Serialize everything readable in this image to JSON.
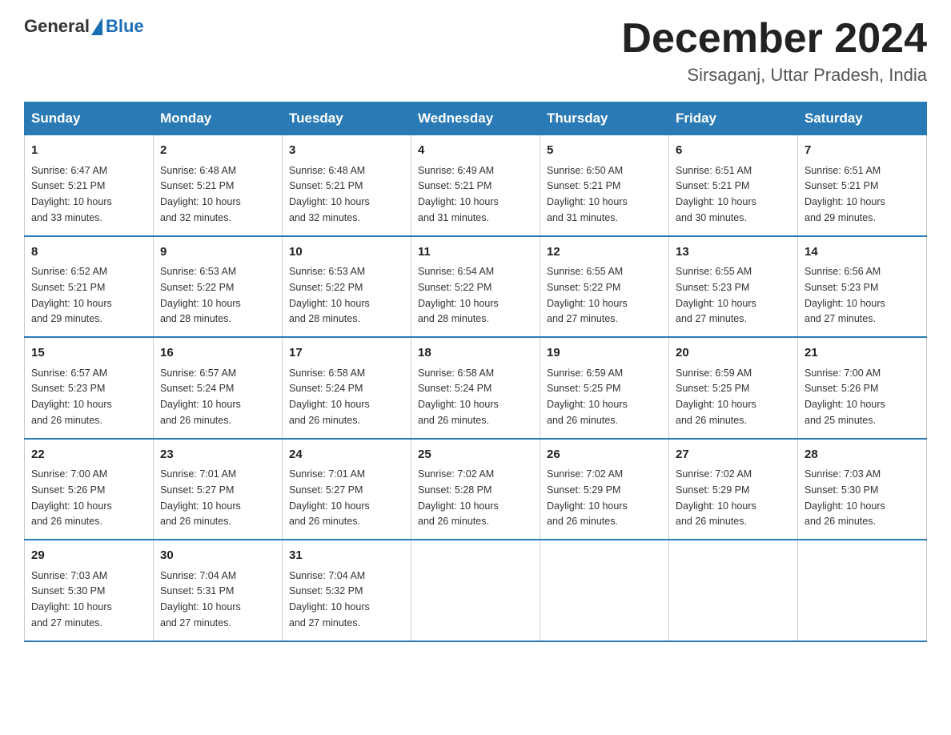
{
  "header": {
    "logo_general": "General",
    "logo_blue": "Blue",
    "month_title": "December 2024",
    "location": "Sirsaganj, Uttar Pradesh, India"
  },
  "days_of_week": [
    "Sunday",
    "Monday",
    "Tuesday",
    "Wednesday",
    "Thursday",
    "Friday",
    "Saturday"
  ],
  "weeks": [
    [
      {
        "day": "1",
        "sunrise": "6:47 AM",
        "sunset": "5:21 PM",
        "daylight": "10 hours and 33 minutes."
      },
      {
        "day": "2",
        "sunrise": "6:48 AM",
        "sunset": "5:21 PM",
        "daylight": "10 hours and 32 minutes."
      },
      {
        "day": "3",
        "sunrise": "6:48 AM",
        "sunset": "5:21 PM",
        "daylight": "10 hours and 32 minutes."
      },
      {
        "day": "4",
        "sunrise": "6:49 AM",
        "sunset": "5:21 PM",
        "daylight": "10 hours and 31 minutes."
      },
      {
        "day": "5",
        "sunrise": "6:50 AM",
        "sunset": "5:21 PM",
        "daylight": "10 hours and 31 minutes."
      },
      {
        "day": "6",
        "sunrise": "6:51 AM",
        "sunset": "5:21 PM",
        "daylight": "10 hours and 30 minutes."
      },
      {
        "day": "7",
        "sunrise": "6:51 AM",
        "sunset": "5:21 PM",
        "daylight": "10 hours and 29 minutes."
      }
    ],
    [
      {
        "day": "8",
        "sunrise": "6:52 AM",
        "sunset": "5:21 PM",
        "daylight": "10 hours and 29 minutes."
      },
      {
        "day": "9",
        "sunrise": "6:53 AM",
        "sunset": "5:22 PM",
        "daylight": "10 hours and 28 minutes."
      },
      {
        "day": "10",
        "sunrise": "6:53 AM",
        "sunset": "5:22 PM",
        "daylight": "10 hours and 28 minutes."
      },
      {
        "day": "11",
        "sunrise": "6:54 AM",
        "sunset": "5:22 PM",
        "daylight": "10 hours and 28 minutes."
      },
      {
        "day": "12",
        "sunrise": "6:55 AM",
        "sunset": "5:22 PM",
        "daylight": "10 hours and 27 minutes."
      },
      {
        "day": "13",
        "sunrise": "6:55 AM",
        "sunset": "5:23 PM",
        "daylight": "10 hours and 27 minutes."
      },
      {
        "day": "14",
        "sunrise": "6:56 AM",
        "sunset": "5:23 PM",
        "daylight": "10 hours and 27 minutes."
      }
    ],
    [
      {
        "day": "15",
        "sunrise": "6:57 AM",
        "sunset": "5:23 PM",
        "daylight": "10 hours and 26 minutes."
      },
      {
        "day": "16",
        "sunrise": "6:57 AM",
        "sunset": "5:24 PM",
        "daylight": "10 hours and 26 minutes."
      },
      {
        "day": "17",
        "sunrise": "6:58 AM",
        "sunset": "5:24 PM",
        "daylight": "10 hours and 26 minutes."
      },
      {
        "day": "18",
        "sunrise": "6:58 AM",
        "sunset": "5:24 PM",
        "daylight": "10 hours and 26 minutes."
      },
      {
        "day": "19",
        "sunrise": "6:59 AM",
        "sunset": "5:25 PM",
        "daylight": "10 hours and 26 minutes."
      },
      {
        "day": "20",
        "sunrise": "6:59 AM",
        "sunset": "5:25 PM",
        "daylight": "10 hours and 26 minutes."
      },
      {
        "day": "21",
        "sunrise": "7:00 AM",
        "sunset": "5:26 PM",
        "daylight": "10 hours and 25 minutes."
      }
    ],
    [
      {
        "day": "22",
        "sunrise": "7:00 AM",
        "sunset": "5:26 PM",
        "daylight": "10 hours and 26 minutes."
      },
      {
        "day": "23",
        "sunrise": "7:01 AM",
        "sunset": "5:27 PM",
        "daylight": "10 hours and 26 minutes."
      },
      {
        "day": "24",
        "sunrise": "7:01 AM",
        "sunset": "5:27 PM",
        "daylight": "10 hours and 26 minutes."
      },
      {
        "day": "25",
        "sunrise": "7:02 AM",
        "sunset": "5:28 PM",
        "daylight": "10 hours and 26 minutes."
      },
      {
        "day": "26",
        "sunrise": "7:02 AM",
        "sunset": "5:29 PM",
        "daylight": "10 hours and 26 minutes."
      },
      {
        "day": "27",
        "sunrise": "7:02 AM",
        "sunset": "5:29 PM",
        "daylight": "10 hours and 26 minutes."
      },
      {
        "day": "28",
        "sunrise": "7:03 AM",
        "sunset": "5:30 PM",
        "daylight": "10 hours and 26 minutes."
      }
    ],
    [
      {
        "day": "29",
        "sunrise": "7:03 AM",
        "sunset": "5:30 PM",
        "daylight": "10 hours and 27 minutes."
      },
      {
        "day": "30",
        "sunrise": "7:04 AM",
        "sunset": "5:31 PM",
        "daylight": "10 hours and 27 minutes."
      },
      {
        "day": "31",
        "sunrise": "7:04 AM",
        "sunset": "5:32 PM",
        "daylight": "10 hours and 27 minutes."
      },
      null,
      null,
      null,
      null
    ]
  ],
  "labels": {
    "sunrise": "Sunrise:",
    "sunset": "Sunset:",
    "daylight": "Daylight:"
  }
}
